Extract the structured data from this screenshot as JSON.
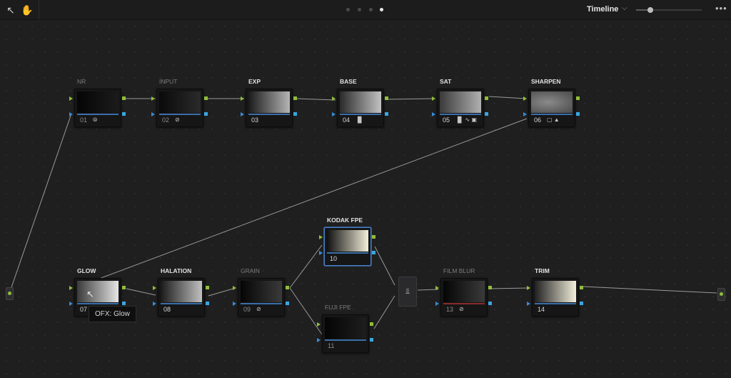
{
  "toolbar": {
    "pointer_icon": "pointer-icon",
    "hand_icon": "hand-icon",
    "pages": [
      {
        "active": false
      },
      {
        "active": false
      },
      {
        "active": false
      },
      {
        "active": true
      }
    ],
    "timeline_label": "Timeline",
    "zoom_level": 0.22,
    "more_icon": "more-icon"
  },
  "nodes": [
    {
      "id": "nr",
      "label": "NR",
      "number": "01",
      "tools": "",
      "dim": true
    },
    {
      "id": "input",
      "label": "INPUT",
      "number": "02",
      "tools": "",
      "dim": true
    },
    {
      "id": "exp",
      "label": "EXP",
      "number": "03",
      "tools": "",
      "dim": false
    },
    {
      "id": "base",
      "label": "BASE",
      "number": "04",
      "tools": "",
      "dim": false
    },
    {
      "id": "sat",
      "label": "SAT",
      "number": "05",
      "tools": "",
      "dim": false
    },
    {
      "id": "sharpen",
      "label": "SHARPEN",
      "number": "06",
      "tools": "",
      "dim": false
    },
    {
      "id": "glow",
      "label": "GLOW",
      "number": "07",
      "tools": "",
      "dim": false
    },
    {
      "id": "halation",
      "label": "HALATION",
      "number": "08",
      "tools": "",
      "dim": false
    },
    {
      "id": "grain",
      "label": "GRAIN",
      "number": "09",
      "tools": "",
      "dim": true
    },
    {
      "id": "kodak",
      "label": "KODAK FPE",
      "number": "10",
      "tools": "",
      "dim": false
    },
    {
      "id": "fuji",
      "label": "FUJI FPE",
      "number": "11",
      "tools": "",
      "dim": true
    },
    {
      "id": "filmblur",
      "label": "FILM BLUR",
      "number": "13",
      "tools": "",
      "dim": true
    },
    {
      "id": "trim",
      "label": "TRIM",
      "number": "14",
      "tools": "",
      "dim": false
    }
  ],
  "tooltip": "OFX: Glow",
  "colors": {
    "accent": "#3a8ad6",
    "green_port": "#8fbe3a",
    "blue_port": "#3aa6e0",
    "selection": "#4a7fc2"
  }
}
